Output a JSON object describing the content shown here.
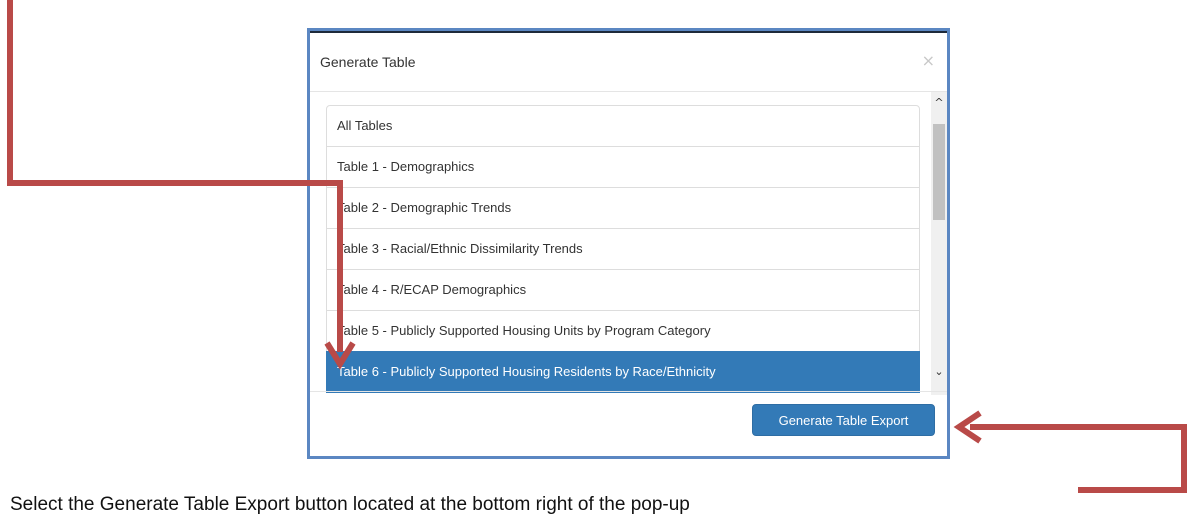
{
  "modal": {
    "title": "Generate Table",
    "close_glyph": "×",
    "list_items": [
      {
        "label": "All Tables",
        "selected": false
      },
      {
        "label": "Table 1 - Demographics",
        "selected": false
      },
      {
        "label": "Table 2 - Demographic Trends",
        "selected": false
      },
      {
        "label": "Table 3 - Racial/Ethnic Dissimilarity Trends",
        "selected": false
      },
      {
        "label": "Table 4 - R/ECAP Demographics",
        "selected": false
      },
      {
        "label": "Table 5 - Publicly Supported Housing Units by Program Category",
        "selected": false
      },
      {
        "label": "Table 6 - Publicly Supported Housing Residents by Race/Ethnicity",
        "selected": true
      }
    ],
    "scroll_up_glyph": "^",
    "scroll_down_glyph": "⌄",
    "export_button_label": "Generate Table Export"
  },
  "caption": "Select the Generate Table Export button located at the bottom right of the pop-up",
  "colors": {
    "accent": "#337ab7",
    "annotation_arrow": "#b94a48",
    "modal_border": "#5b87c2"
  }
}
